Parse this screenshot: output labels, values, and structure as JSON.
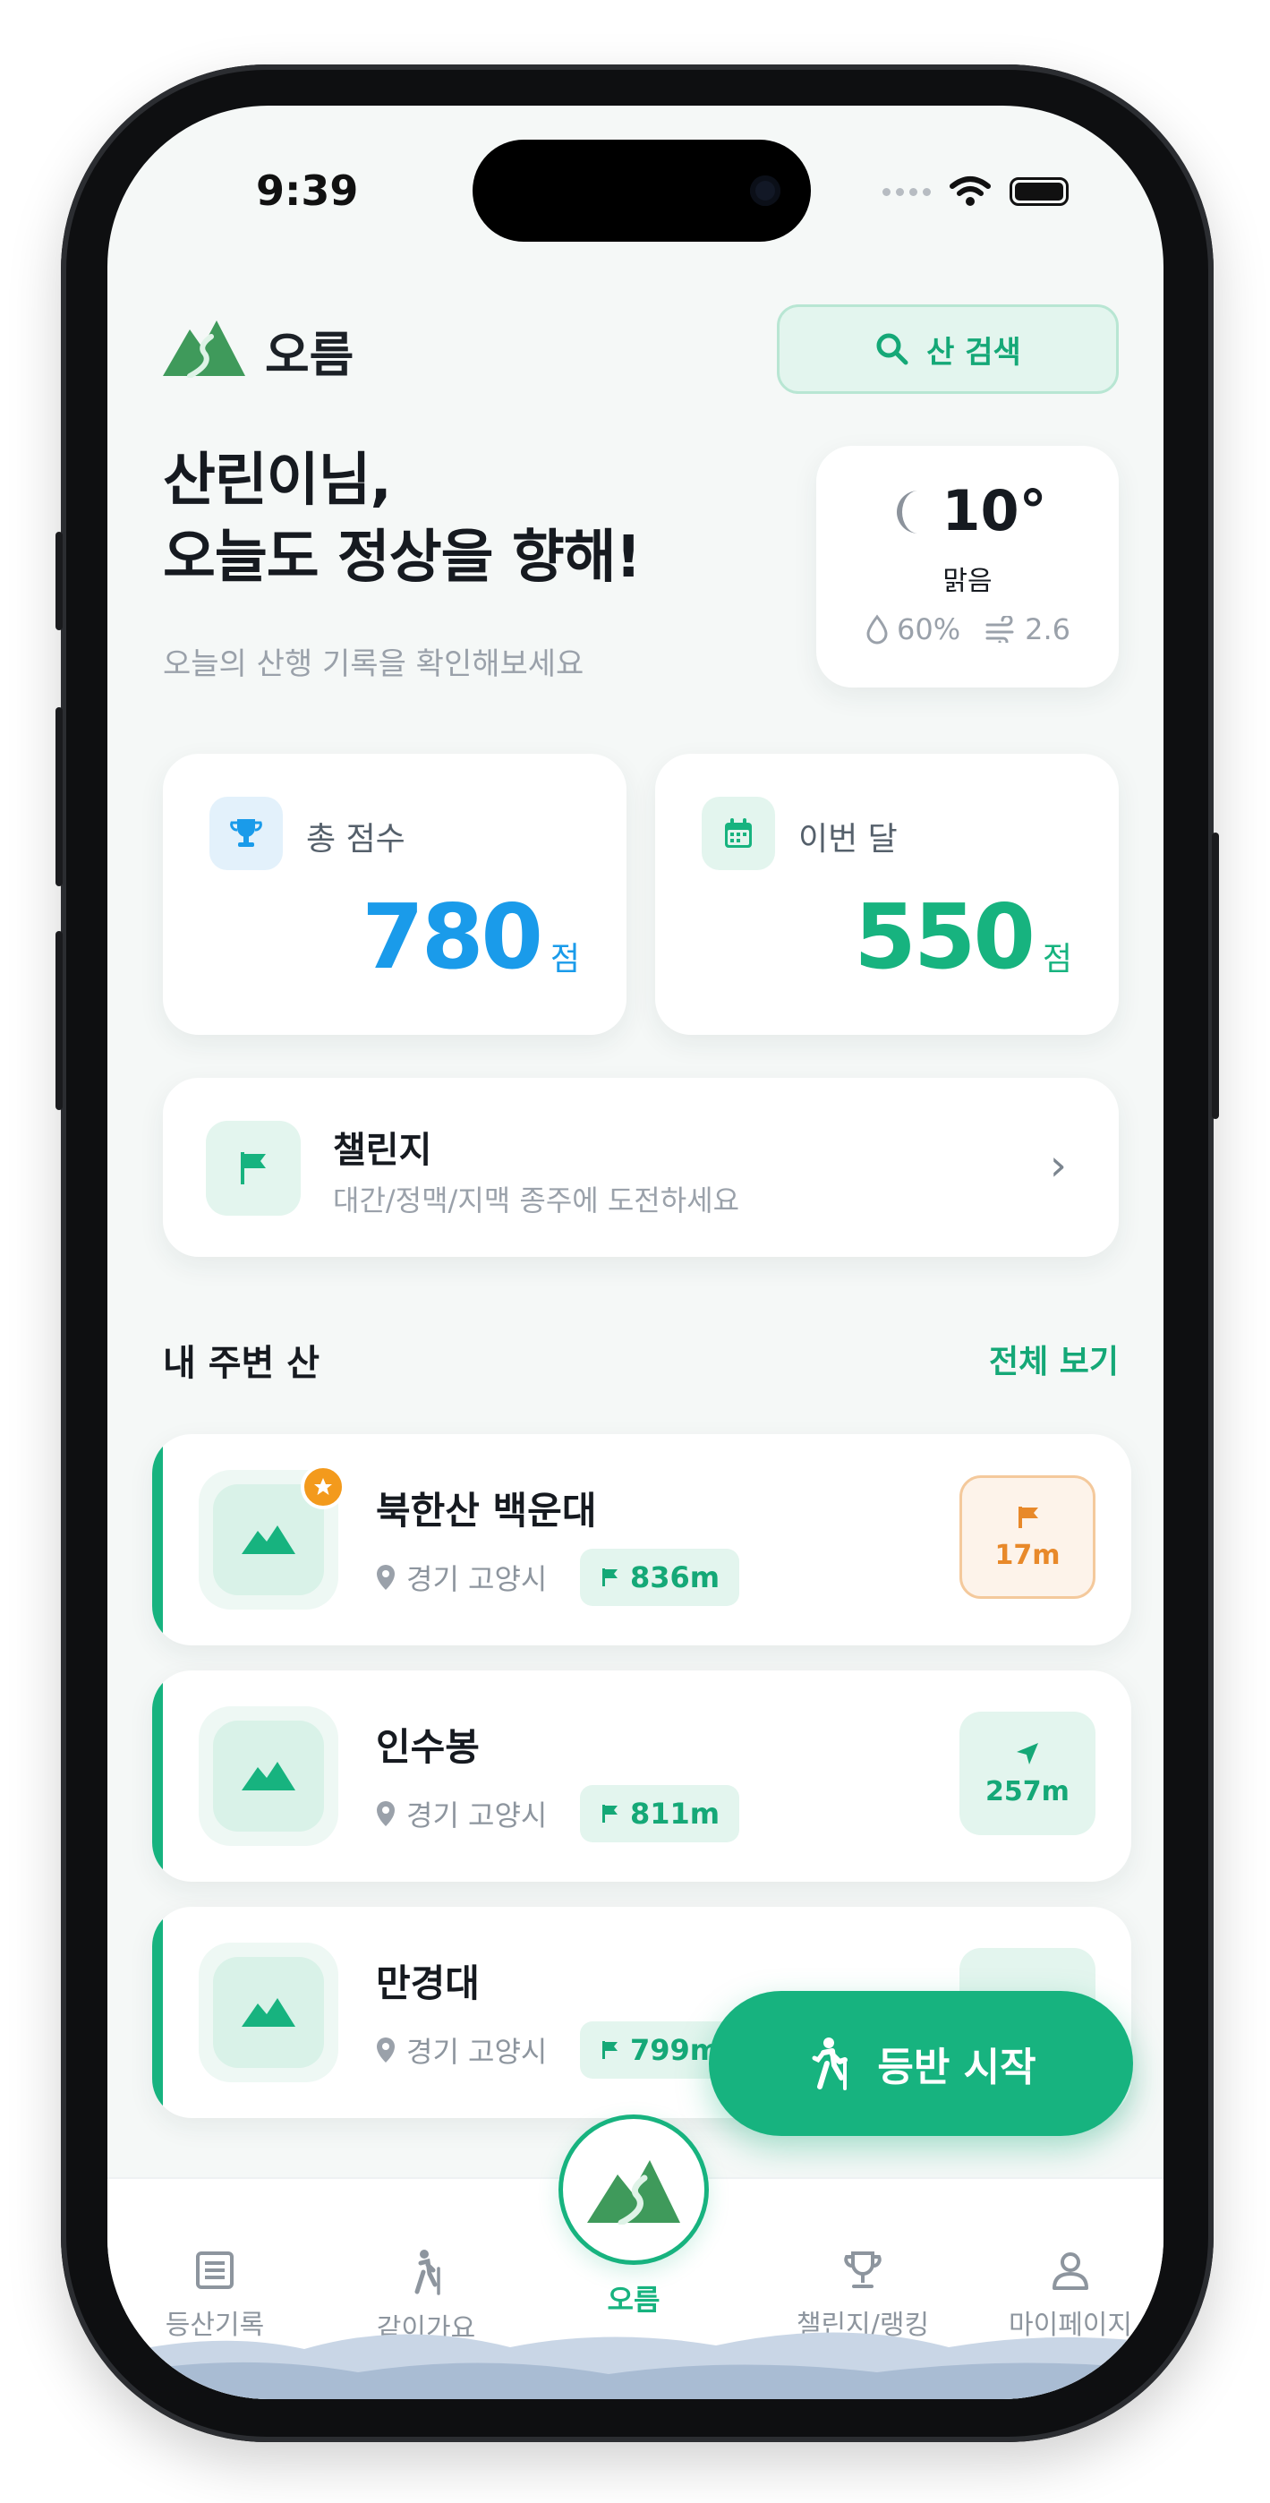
{
  "status": {
    "time": "9:39"
  },
  "header": {
    "app_name": "오름",
    "search_label": "산 검색"
  },
  "greeting": {
    "line1": "산린이님,",
    "line2": "오늘도 정상을 향해!",
    "subtitle": "오늘의 산행 기록을 확인해보세요"
  },
  "weather": {
    "temp": "10°",
    "condition": "맑음",
    "humidity": "60%",
    "wind": "2.6"
  },
  "stats": [
    {
      "label": "총 점수",
      "value": "780",
      "unit": "점",
      "color": "#1a9bea"
    },
    {
      "label": "이번 달",
      "value": "550",
      "unit": "점",
      "color": "#17b37f"
    }
  ],
  "challenge": {
    "title": "챌린지",
    "subtitle": "대간/정맥/지맥 종주에 도전하세요"
  },
  "nearby": {
    "title": "내 주변 산",
    "see_all": "전체 보기",
    "items": [
      {
        "name": "북한산 백운대",
        "location": "경기 고양시",
        "altitude": "836m",
        "distance": "17m",
        "favorite": true,
        "status": "flag"
      },
      {
        "name": "인수봉",
        "location": "경기 고양시",
        "altitude": "811m",
        "distance": "257m",
        "favorite": false,
        "status": "navigate"
      },
      {
        "name": "만경대",
        "location": "경기 고양시",
        "altitude": "799m",
        "distance": "",
        "favorite": false,
        "status": "navigate"
      }
    ]
  },
  "fab": {
    "label": "등반 시작"
  },
  "tabs": [
    {
      "label": "등산기록",
      "icon": "list-icon"
    },
    {
      "label": "같이가요",
      "icon": "hiker-icon"
    },
    {
      "label": "오름",
      "icon": "mountain-icon"
    },
    {
      "label": "챌린지/랭킹",
      "icon": "trophy-icon"
    },
    {
      "label": "마이페이지",
      "icon": "person-icon"
    }
  ],
  "colors": {
    "accent": "#17b37f",
    "blue": "#1a9bea",
    "orange": "#e8892a"
  }
}
